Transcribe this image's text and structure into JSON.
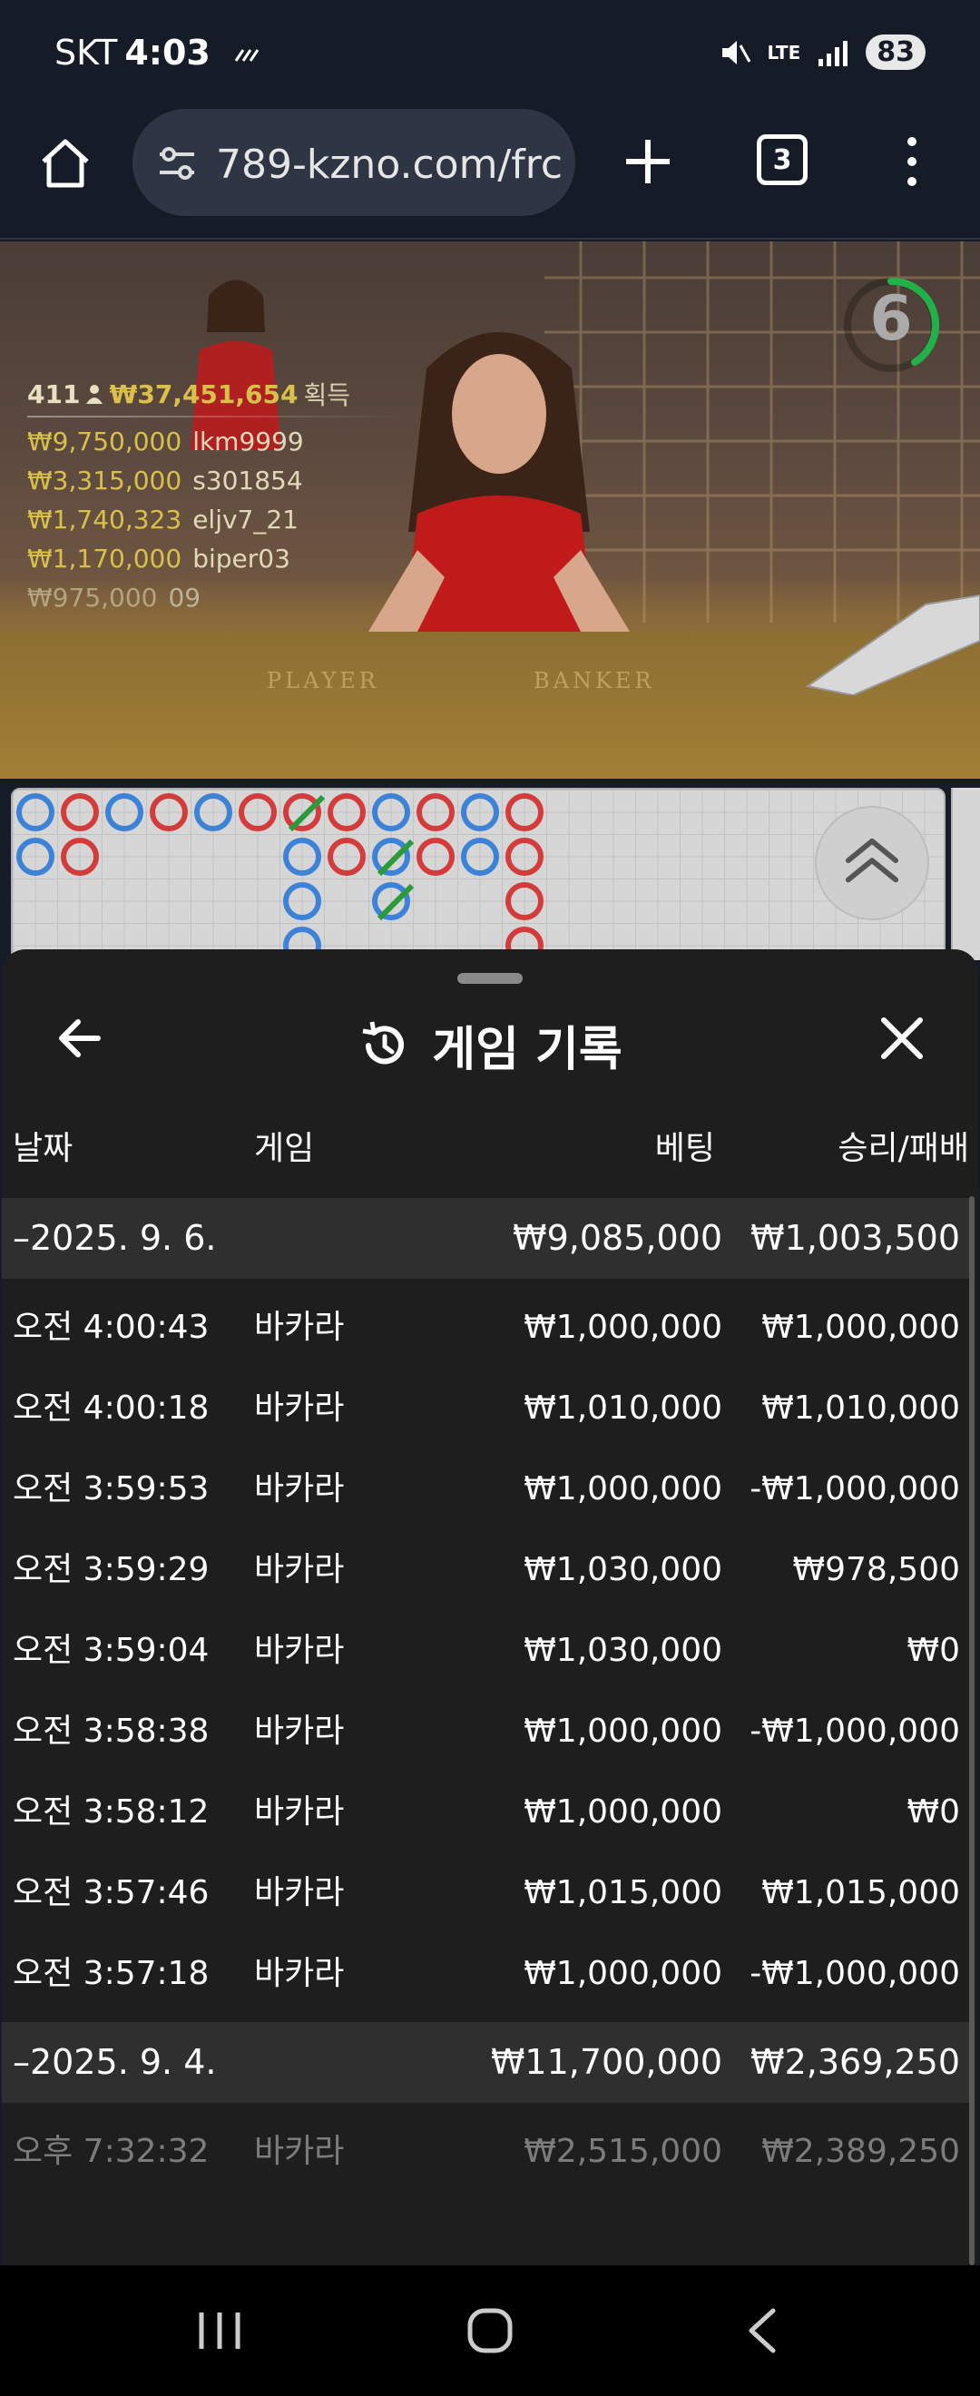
{
  "status_bar": {
    "carrier": "SKT",
    "time": "4:03",
    "network": "LTE",
    "battery": "83"
  },
  "browser": {
    "url": "789-kzno.com/frc",
    "tab_count": "3"
  },
  "stream": {
    "timer": "6",
    "table_labels": {
      "player": "PLAYER",
      "banker": "BANKER"
    },
    "winners": {
      "viewer_count": "411",
      "total": "₩37,451,654",
      "total_suffix": "획득",
      "rows": [
        {
          "amount": "₩9,750,000",
          "name": "lkm9999"
        },
        {
          "amount": "₩3,315,000",
          "name": "s301854"
        },
        {
          "amount": "₩1,740,323",
          "name": "eljv7_21"
        },
        {
          "amount": "₩1,170,000",
          "name": "biper03"
        },
        {
          "amount": "₩975,000",
          "name": "09"
        }
      ]
    }
  },
  "history": {
    "title": "게임 기록",
    "columns": {
      "date": "날짜",
      "game": "게임",
      "bet": "베팅",
      "win_loss": "승리/패배"
    },
    "groups": [
      {
        "date": "–2025. 9. 6.",
        "bet_total": "₩9,085,000",
        "win_total": "₩1,003,500",
        "rows": [
          {
            "time": "오전 4:00:43",
            "game": "바카라",
            "bet": "₩1,000,000",
            "result": "₩1,000,000"
          },
          {
            "time": "오전 4:00:18",
            "game": "바카라",
            "bet": "₩1,010,000",
            "result": "₩1,010,000"
          },
          {
            "time": "오전 3:59:53",
            "game": "바카라",
            "bet": "₩1,000,000",
            "result": "-₩1,000,000"
          },
          {
            "time": "오전 3:59:29",
            "game": "바카라",
            "bet": "₩1,030,000",
            "result": "₩978,500"
          },
          {
            "time": "오전 3:59:04",
            "game": "바카라",
            "bet": "₩1,030,000",
            "result": "₩0"
          },
          {
            "time": "오전 3:58:38",
            "game": "바카라",
            "bet": "₩1,000,000",
            "result": "-₩1,000,000"
          },
          {
            "time": "오전 3:58:12",
            "game": "바카라",
            "bet": "₩1,000,000",
            "result": "₩0"
          },
          {
            "time": "오전 3:57:46",
            "game": "바카라",
            "bet": "₩1,015,000",
            "result": "₩1,015,000"
          },
          {
            "time": "오전 3:57:18",
            "game": "바카라",
            "bet": "₩1,000,000",
            "result": "-₩1,000,000"
          }
        ]
      },
      {
        "date": "–2025. 9. 4.",
        "bet_total": "₩11,700,000",
        "win_total": "₩2,369,250",
        "rows": [
          {
            "time": "오후 7:32:32",
            "game": "바카라",
            "bet": "₩2,515,000",
            "result": "₩2,389,250"
          }
        ]
      }
    ]
  },
  "colors": {
    "banker_bead": "#d43c3c",
    "player_bead": "#3c82d6",
    "tie_mark": "#2a9a3a",
    "timer_ring": "#22b04a",
    "winner_gold": "#d8c04a"
  },
  "icons": {
    "home": "home-icon",
    "site_settings": "tune-icon",
    "new_tab": "plus-icon",
    "menu": "more-vert-icon",
    "history": "history-icon",
    "back": "arrow-left-icon",
    "close": "close-icon",
    "scroll_up": "double-chevron-up-icon"
  }
}
